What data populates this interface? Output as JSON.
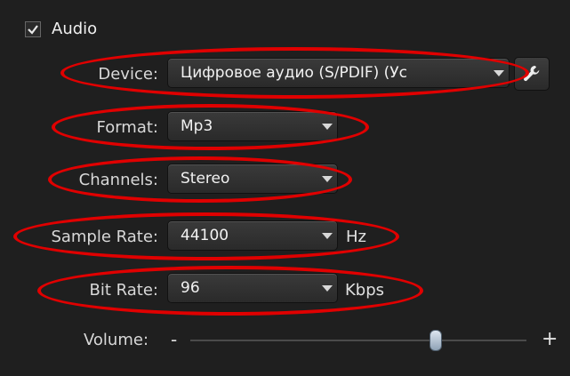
{
  "audio": {
    "enabled": true,
    "section_label": "Audio",
    "device": {
      "label": "Device:",
      "value": "Цифровое аудио (S/PDIF) (Ус"
    },
    "format": {
      "label": "Format:",
      "value": "Mp3"
    },
    "channels": {
      "label": "Channels:",
      "value": "Stereo"
    },
    "sample_rate": {
      "label": "Sample Rate:",
      "value": "44100",
      "unit": "Hz"
    },
    "bit_rate": {
      "label": "Bit Rate:",
      "value": "96",
      "unit": "Kbps"
    },
    "volume": {
      "label": "Volume:",
      "minus": "-",
      "plus": "+",
      "level": 0.73
    }
  },
  "icons": {
    "checkbox": "checkmark-icon",
    "device_settings": "wrench-icon",
    "dropdown": "chevron-down-icon"
  },
  "colors": {
    "annotation": "#e00000",
    "background": "#1f1f1f"
  }
}
